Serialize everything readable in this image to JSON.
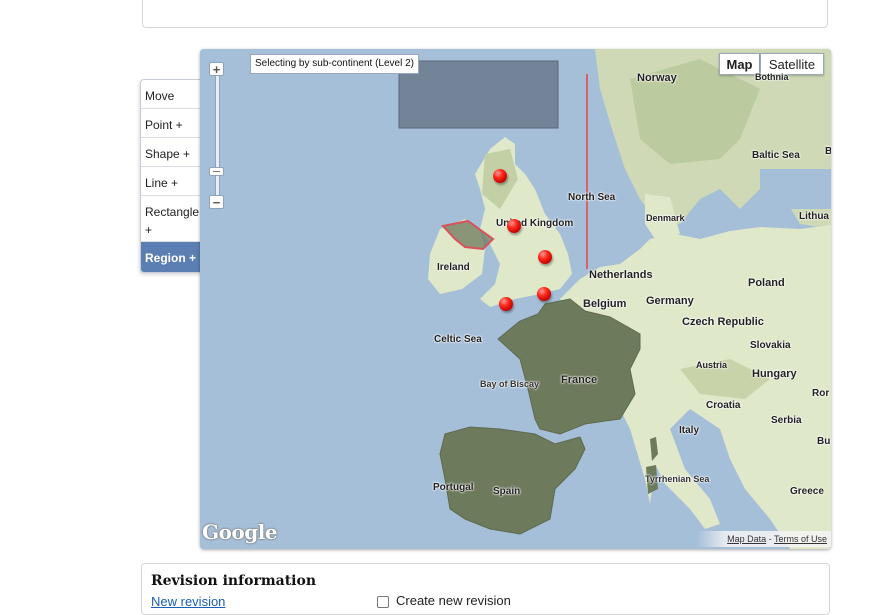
{
  "toolbar": {
    "items": [
      {
        "label": "Move"
      },
      {
        "label": "Point +"
      },
      {
        "label": "Shape +"
      },
      {
        "label": "Line +"
      },
      {
        "label": "Rectangle +"
      },
      {
        "label": "Region +",
        "active": true
      }
    ]
  },
  "map": {
    "mode_label": "Selecting by sub-continent (Level 2)",
    "map_types": [
      {
        "label": "Map",
        "active": true
      },
      {
        "label": "Satellite",
        "active": false
      }
    ],
    "zoom_in_icon": "plus-icon",
    "zoom_out_icon": "minus-icon",
    "labels": {
      "norway": "Norway",
      "bothnia": "Bothnia",
      "baltic_sea": "Baltic Sea",
      "b_edge": "B",
      "north_sea": "North Sea",
      "denmark": "Denmark",
      "lithuania": "Lithua",
      "united_kingdom": "United Kingdom",
      "ireland": "Ireland",
      "netherlands": "Netherlands",
      "poland": "Poland",
      "belgium": "Belgium",
      "germany": "Germany",
      "czech_republic": "Czech Republic",
      "celtic_sea": "Celtic Sea",
      "slovakia": "Slovakia",
      "austria": "Austria",
      "hungary": "Hungary",
      "ro_edge": "Ror",
      "france": "France",
      "bay_of_biscay": "Bay of Biscay",
      "croatia": "Croatia",
      "serbia": "Serbia",
      "bu_edge": "Bu",
      "italy": "Italy",
      "portugal": "Portugal",
      "spain": "Spain",
      "tyrrhenian_sea": "Tyrrhenian Sea",
      "greece": "Greece"
    },
    "markers_count": 5,
    "logo": "Google",
    "attribution": {
      "map_data": "Map Data",
      "separator": "-",
      "terms": "Terms of Use"
    },
    "colors": {
      "water": "#a6bfd9",
      "land": "#dfe8c9",
      "selected_region": "#6e7a5c",
      "marker": "#e00000",
      "line": "#d9616c"
    }
  },
  "revision": {
    "title": "Revision information",
    "link": "New revision",
    "checkbox_label": "Create new revision"
  }
}
